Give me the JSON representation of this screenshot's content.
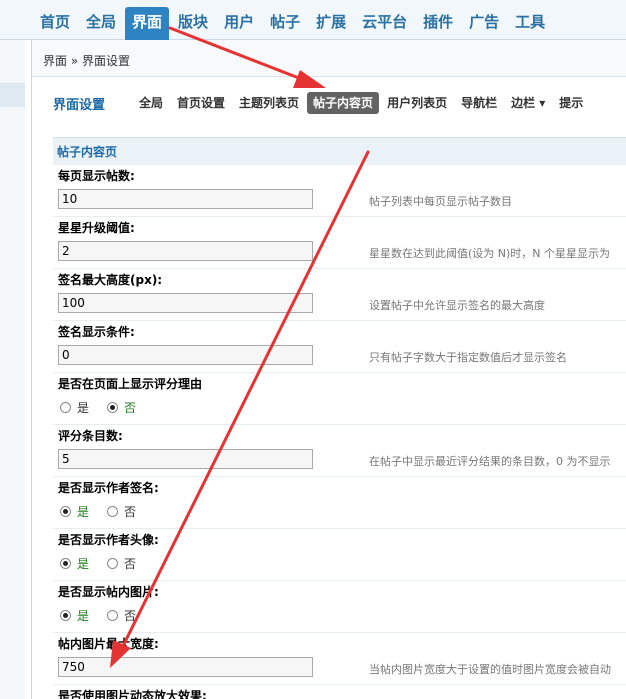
{
  "topnav": {
    "items": [
      {
        "label": "首页"
      },
      {
        "label": "全局"
      },
      {
        "label": "界面"
      },
      {
        "label": "版块"
      },
      {
        "label": "用户"
      },
      {
        "label": "帖子"
      },
      {
        "label": "扩展"
      },
      {
        "label": "云平台"
      },
      {
        "label": "插件"
      },
      {
        "label": "广告"
      },
      {
        "label": "工具"
      }
    ],
    "active_index": 2
  },
  "breadcrumb": "界面 » 界面设置",
  "subnav": {
    "title": "界面设置",
    "tabs": [
      {
        "label": "全局"
      },
      {
        "label": "首页设置"
      },
      {
        "label": "主题列表页"
      },
      {
        "label": "帖子内容页"
      },
      {
        "label": "用户列表页"
      },
      {
        "label": "导航栏"
      },
      {
        "label": "边栏 ▾"
      },
      {
        "label": "提示"
      }
    ],
    "active_index": 3
  },
  "section": {
    "title": "帖子内容页"
  },
  "settings": {
    "per_page": {
      "label": "每页显示帖数:",
      "value": "10",
      "tip": "帖子列表中每页显示帖子数目"
    },
    "star_threshold": {
      "label": "星星升级阈值:",
      "value": "2",
      "tip": "星星数在达到此阈值(设为 N)时，N 个星星显示为"
    },
    "sig_max_height": {
      "label": "签名最大高度(px):",
      "value": "100",
      "tip": "设置帖子中允许显示签名的最大高度"
    },
    "sig_condition": {
      "label": "签名显示条件:",
      "value": "0",
      "tip": "只有帖子字数大于指定数值后才显示签名"
    },
    "show_rate_reason": {
      "label": "是否在页面上显示评分理由",
      "yes": "是",
      "no": "否",
      "selected": "no"
    },
    "rate_count": {
      "label": "评分条目数:",
      "value": "5",
      "tip": "在帖子中显示最近评分结果的条目数，0 为不显示"
    },
    "show_author_sig": {
      "label": "是否显示作者签名:",
      "yes": "是",
      "no": "否",
      "selected": "yes"
    },
    "show_author_avatar": {
      "label": "是否显示作者头像:",
      "yes": "是",
      "no": "否",
      "selected": "yes"
    },
    "show_post_images": {
      "label": "是否显示帖内图片:",
      "yes": "是",
      "no": "否",
      "selected": "yes"
    },
    "max_image_width": {
      "label": "帖内图片最大宽度:",
      "value": "750",
      "tip": "当帖内图片宽度大于设置的值时图片宽度会被自动"
    },
    "image_zoom": {
      "label": "是否使用图片动态放大效果:"
    }
  },
  "colors": {
    "nav_active": "#2e83c2",
    "nav_text": "#2b72a4",
    "tab_active": "#636363",
    "accent_title": "#1d6aa8",
    "arrow": "#e53333"
  }
}
